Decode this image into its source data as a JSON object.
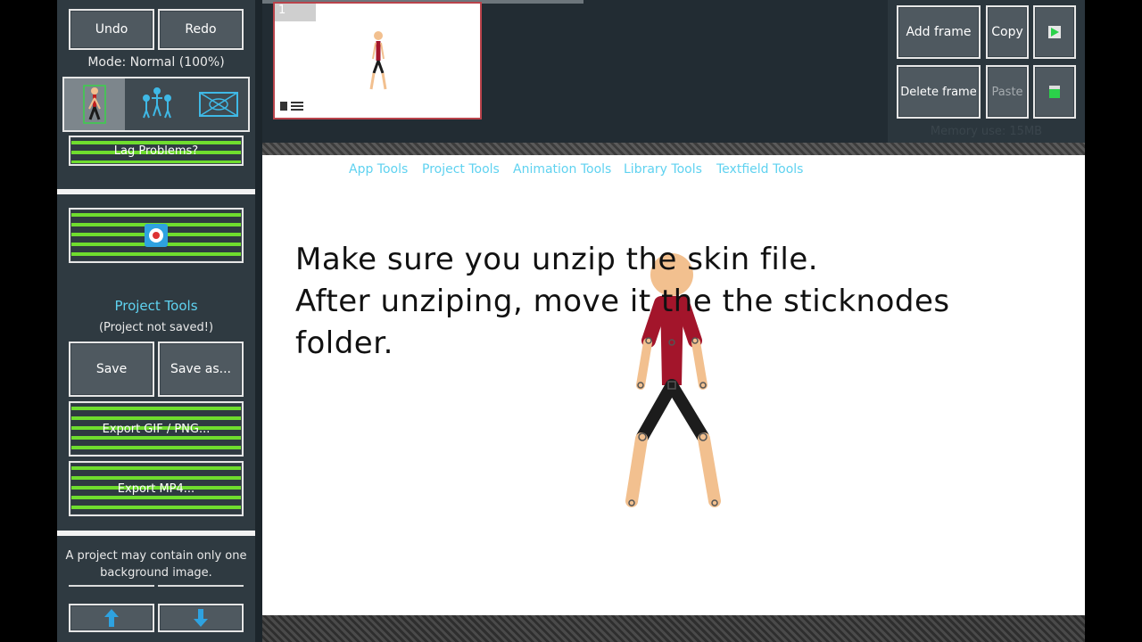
{
  "toolbar": {
    "undo_label": "Undo",
    "redo_label": "Redo",
    "mode_text": "Mode: Normal (100%)",
    "lag_label": "Lag Problems?"
  },
  "project_tools": {
    "heading": "Project Tools",
    "status": "(Project not saved!)",
    "save_label": "Save",
    "save_as_label": "Save as...",
    "export_gif_label": "Export GIF / PNG...",
    "export_mp4_label": "Export MP4..."
  },
  "background_note": "A project may contain only one background image.",
  "frames": {
    "current_frame_number": "1",
    "add_frame_label": "Add frame",
    "copy_label": "Copy",
    "delete_frame_label": "Delete frame",
    "paste_label": "Paste",
    "memory_text": "Memory use: 15MB"
  },
  "menu": {
    "items": [
      "App Tools",
      "Project Tools",
      "Animation Tools",
      "Library Tools",
      "Textfield Tools"
    ]
  },
  "canvas": {
    "caption_lines": [
      "Make sure you unzip the skin file.",
      "After unziping, move it the the sticknodes",
      "folder."
    ]
  },
  "colors": {
    "accent_cyan": "#5fd2f0",
    "panel_bg": "#2f3a41",
    "stick_shirt": "#a3152b",
    "stick_skin": "#f2c08f",
    "stick_pants": "#1c1c1c",
    "highlight_green": "#6fdd2e"
  },
  "icons": {
    "stickfigure_tool": "stickfigure-icon",
    "group_tool": "group-icon",
    "background_tool": "background-image-icon",
    "settings": "gear-icon",
    "move_up": "arrow-up-icon",
    "move_down": "arrow-down-icon"
  }
}
